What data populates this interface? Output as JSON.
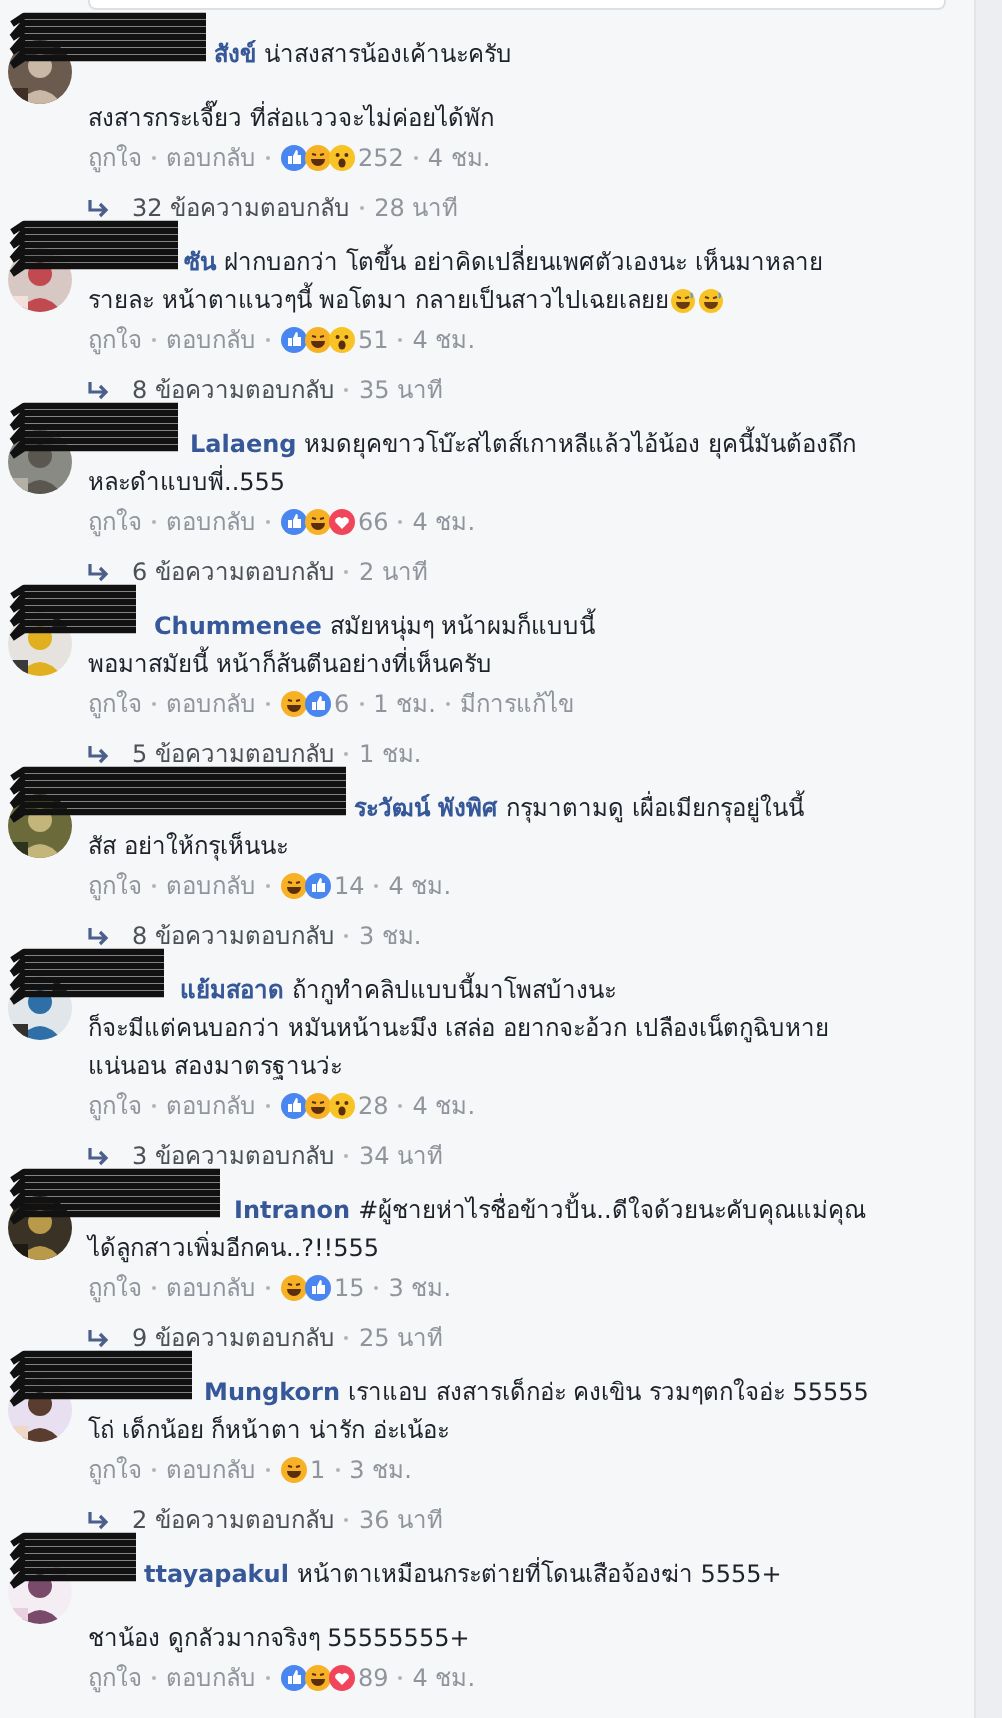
{
  "comments": [
    {
      "name": "สังข์",
      "redacted": true,
      "paragraphs": [
        [
          "น่าสงสารน้องเค้านะครับ"
        ],
        [
          "สงสารกระเจี๊ยว ที่ส่อแววจะไม่ค่อยได้พัก"
        ]
      ],
      "actions": [
        "ถูกใจ",
        "ตอบกลับ"
      ],
      "reactions": [
        {
          "kind": "like"
        },
        {
          "kind": "haha"
        },
        {
          "kind": "wow"
        }
      ],
      "reaction_count": "252",
      "time": "4 ชม.",
      "replies": {
        "label": "32 ข้อความตอบกลับ",
        "time": "28 นาที"
      }
    },
    {
      "name": "ซัน",
      "redacted": true,
      "paragraphs": [
        [
          "ฝากบอกว่า โตขึ้น อย่าคิดเปลี่ยนเพศตัวเองนะ เห็นมาหลาย",
          "รายละ หน้าตาแนวๆนี้ พอโตมา กลายเป็นสาวไปเฉยเลยย"
        ]
      ],
      "trailing_emoji": [
        {
          "kind": "grin"
        },
        {
          "kind": "grin"
        }
      ],
      "actions": [
        "ถูกใจ",
        "ตอบกลับ"
      ],
      "reactions": [
        {
          "kind": "like"
        },
        {
          "kind": "haha"
        },
        {
          "kind": "wow"
        }
      ],
      "reaction_count": "51",
      "time": "4 ชม.",
      "replies": {
        "label": "8 ข้อความตอบกลับ",
        "time": "35 นาที"
      }
    },
    {
      "name": "Lalaeng",
      "redacted": true,
      "paragraphs": [
        [
          "หมดยุคขาวโบ๊ะสไตส์เกาหลีแล้วไอ้น้อง ยุคนี้มันต้องถึก",
          "หละดำแบบพี่..555"
        ]
      ],
      "actions": [
        "ถูกใจ",
        "ตอบกลับ"
      ],
      "reactions": [
        {
          "kind": "like"
        },
        {
          "kind": "haha"
        },
        {
          "kind": "love"
        }
      ],
      "reaction_count": "66",
      "time": "4 ชม.",
      "replies": {
        "label": "6 ข้อความตอบกลับ",
        "time": "2 นาที"
      }
    },
    {
      "name": "Chummenee",
      "redacted": true,
      "paragraphs": [
        [
          "สมัยหนุ่มๆ หน้าผมก็แบบนี้",
          "พอมาสมัยนี้ หน้าก็ส้นตีนอย่างที่เห็นครับ"
        ]
      ],
      "actions": [
        "ถูกใจ",
        "ตอบกลับ"
      ],
      "reactions": [
        {
          "kind": "haha"
        },
        {
          "kind": "like"
        }
      ],
      "reaction_count": "6",
      "time": "1 ชม.",
      "edited": "มีการแก้ไข",
      "replies": {
        "label": "5 ข้อความตอบกลับ",
        "time": "1 ชม."
      }
    },
    {
      "name": "ระวัฒน์ พังพิศ",
      "redacted": true,
      "paragraphs": [
        [
          "กรุมาตามดู เผื่อเมียกรุอยู่ในนี้",
          "สัส อย่าให้กรุเห็นนะ"
        ]
      ],
      "actions": [
        "ถูกใจ",
        "ตอบกลับ"
      ],
      "reactions": [
        {
          "kind": "haha"
        },
        {
          "kind": "like"
        }
      ],
      "reaction_count": "14",
      "time": "4 ชม.",
      "replies": {
        "label": "8 ข้อความตอบกลับ",
        "time": "3 ชม."
      }
    },
    {
      "name": "แย้มสอาด",
      "redacted": true,
      "paragraphs": [
        [
          "ถ้ากูทำคลิปแบบนี้มาโพสบ้างนะ",
          "ก็จะมีแต่คนบอกว่า หมันหน้านะมึง เสล่อ อยากจะอ้วก เปลืองเน็ตกูฉิบหาย",
          "แน่นอน สองมาตรฐานว่ะ"
        ]
      ],
      "actions": [
        "ถูกใจ",
        "ตอบกลับ"
      ],
      "reactions": [
        {
          "kind": "like"
        },
        {
          "kind": "haha"
        },
        {
          "kind": "wow"
        }
      ],
      "reaction_count": "28",
      "time": "4 ชม.",
      "replies": {
        "label": "3 ข้อความตอบกลับ",
        "time": "34 นาที"
      }
    },
    {
      "name": "Intranon",
      "redacted": true,
      "paragraphs": [
        [
          "#ผู้ชายห่าไรชื่อข้าวปั้น..ดีใจด้วยนะคับคุณแม่คุณ",
          "ได้ลูกสาวเพิ่มอีกคน..?!!555"
        ]
      ],
      "actions": [
        "ถูกใจ",
        "ตอบกลับ"
      ],
      "reactions": [
        {
          "kind": "haha"
        },
        {
          "kind": "like"
        }
      ],
      "reaction_count": "15",
      "time": "3 ชม.",
      "replies": {
        "label": "9 ข้อความตอบกลับ",
        "time": "25 นาที"
      }
    },
    {
      "name": "Mungkorn",
      "redacted": true,
      "paragraphs": [
        [
          "เราแอบ สงสารเด็กอ่ะ คงเขิน รวมๆตกใจอ่ะ 55555",
          "โถ่ เด็กน้อย ก็หน้าตา น่ารัก อ่ะเน้อะ"
        ]
      ],
      "actions": [
        "ถูกใจ",
        "ตอบกลับ"
      ],
      "reactions": [
        {
          "kind": "haha"
        }
      ],
      "reaction_count": "1",
      "time": "3 ชม.",
      "replies": {
        "label": "2 ข้อความตอบกลับ",
        "time": "36 นาที"
      }
    },
    {
      "name": "ttayapakul",
      "redacted": true,
      "paragraphs": [
        [
          "หน้าตาเหมือนกระต่ายที่โดนเสือจ้องฆ่า 5555+"
        ],
        [
          "ชาน้อง ดูกลัวมากจริงๆ 55555555+"
        ]
      ],
      "actions": [
        "ถูกใจ",
        "ตอบกลับ"
      ],
      "reactions": [
        {
          "kind": "like"
        },
        {
          "kind": "haha"
        },
        {
          "kind": "love"
        }
      ],
      "reaction_count": "89",
      "time": "4 ชม."
    }
  ]
}
